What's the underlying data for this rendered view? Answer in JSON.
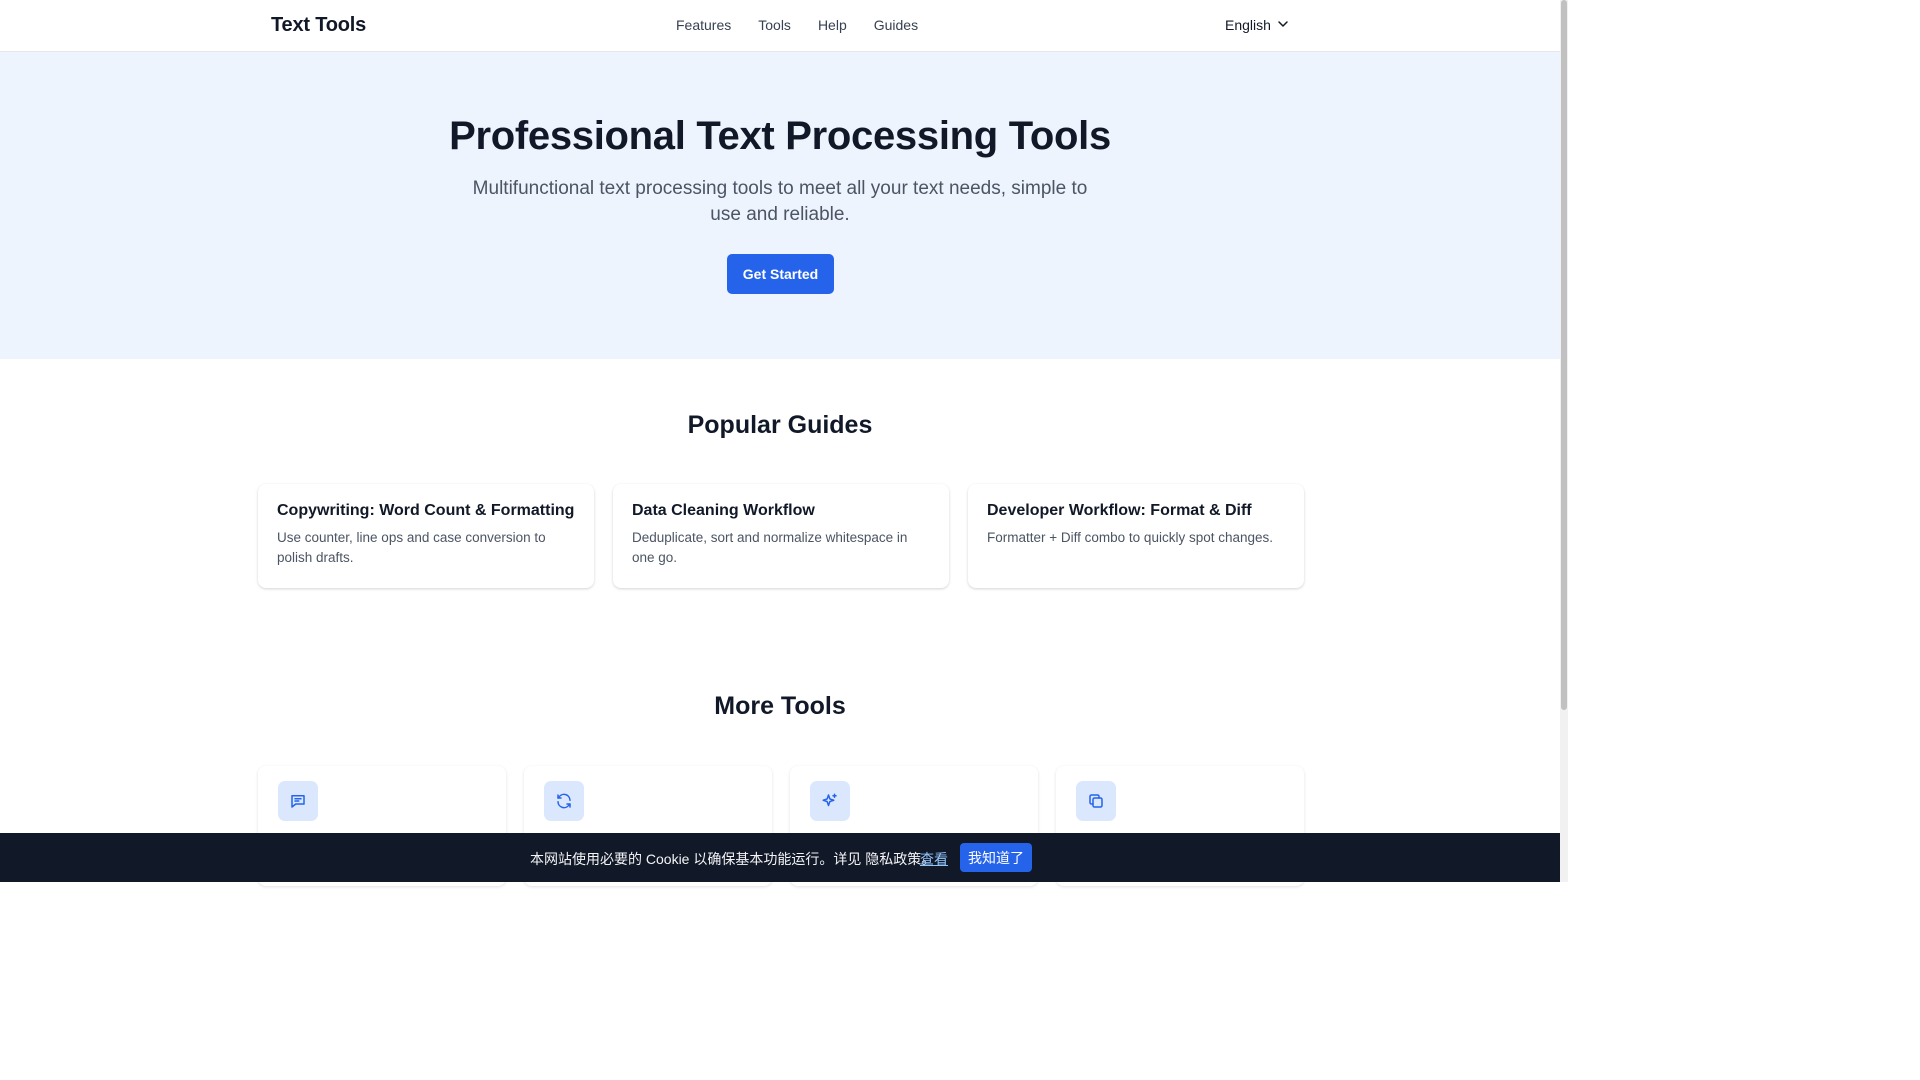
{
  "header": {
    "brand": "Text Tools",
    "nav": [
      "Features",
      "Tools",
      "Help",
      "Guides"
    ],
    "language": "English"
  },
  "hero": {
    "title": "Professional Text Processing Tools",
    "subtitle": "Multifunctional text processing tools to meet all your text needs, simple to use and reliable.",
    "cta": "Get Started"
  },
  "guides": {
    "title": "Popular Guides",
    "items": [
      {
        "title": "Copywriting: Word Count & Formatting",
        "desc": "Use counter, line ops and case conversion to polish drafts."
      },
      {
        "title": "Data Cleaning Workflow",
        "desc": "Deduplicate, sort and normalize whitespace in one go."
      },
      {
        "title": "Developer Workflow: Format & Diff",
        "desc": "Formatter + Diff combo to quickly spot changes."
      }
    ]
  },
  "tools": {
    "title": "More Tools",
    "icons": [
      "message-icon",
      "refresh-icon",
      "sparkles-icon",
      "copy-icon"
    ]
  },
  "cookie": {
    "text": "本网站使用必要的 Cookie 以确保基本功能运行。详见 隐私政策。",
    "link": "查看",
    "button": "我知道了"
  },
  "colors": {
    "accent": "#2563eb",
    "hero_bg": "#eef4fe",
    "icon_bg": "#dbe7fd",
    "cookie_bg": "#111827"
  }
}
